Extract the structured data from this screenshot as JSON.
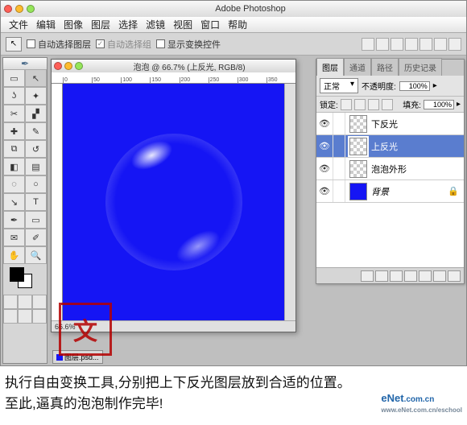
{
  "app": {
    "title": "Adobe Photoshop"
  },
  "menu": [
    "文件",
    "编辑",
    "图像",
    "图层",
    "选择",
    "滤镜",
    "视图",
    "窗口",
    "帮助"
  ],
  "options": {
    "auto_select_layer": "自动选择图层",
    "auto_select_group": "自动选择组",
    "show_transform": "显示变换控件"
  },
  "document": {
    "title": "泡泡 @ 66.7% (上反光, RGB/8)",
    "zoom": "66.6%",
    "ruler_marks": [
      "0",
      "50",
      "100",
      "150",
      "200",
      "250",
      "300",
      "350"
    ]
  },
  "layers_panel": {
    "tabs": [
      "图层",
      "通道",
      "路径",
      "历史记录"
    ],
    "blend_mode": "正常",
    "opacity_label": "不透明度:",
    "opacity_value": "100%",
    "lock_label": "锁定:",
    "fill_label": "填充:",
    "fill_value": "100%",
    "layers": [
      {
        "name": "下反光",
        "visible": true,
        "selected": false,
        "thumb": "trans"
      },
      {
        "name": "上反光",
        "visible": true,
        "selected": true,
        "thumb": "trans"
      },
      {
        "name": "泡泡外形",
        "visible": true,
        "selected": false,
        "thumb": "trans"
      },
      {
        "name": "背景",
        "visible": true,
        "selected": false,
        "thumb": "blue",
        "italic": true
      }
    ]
  },
  "doctab": "图层.psd...",
  "caption_line1": "执行自由变换工具,分别把上下反光图层放到合适的位置。",
  "caption_line2": "至此,逼真的泡泡制作完毕!",
  "watermark": {
    "main": "eNet",
    "domain": ".com.cn",
    "sub": "www.eNet.com.cn/eschool"
  },
  "stamp": "文"
}
